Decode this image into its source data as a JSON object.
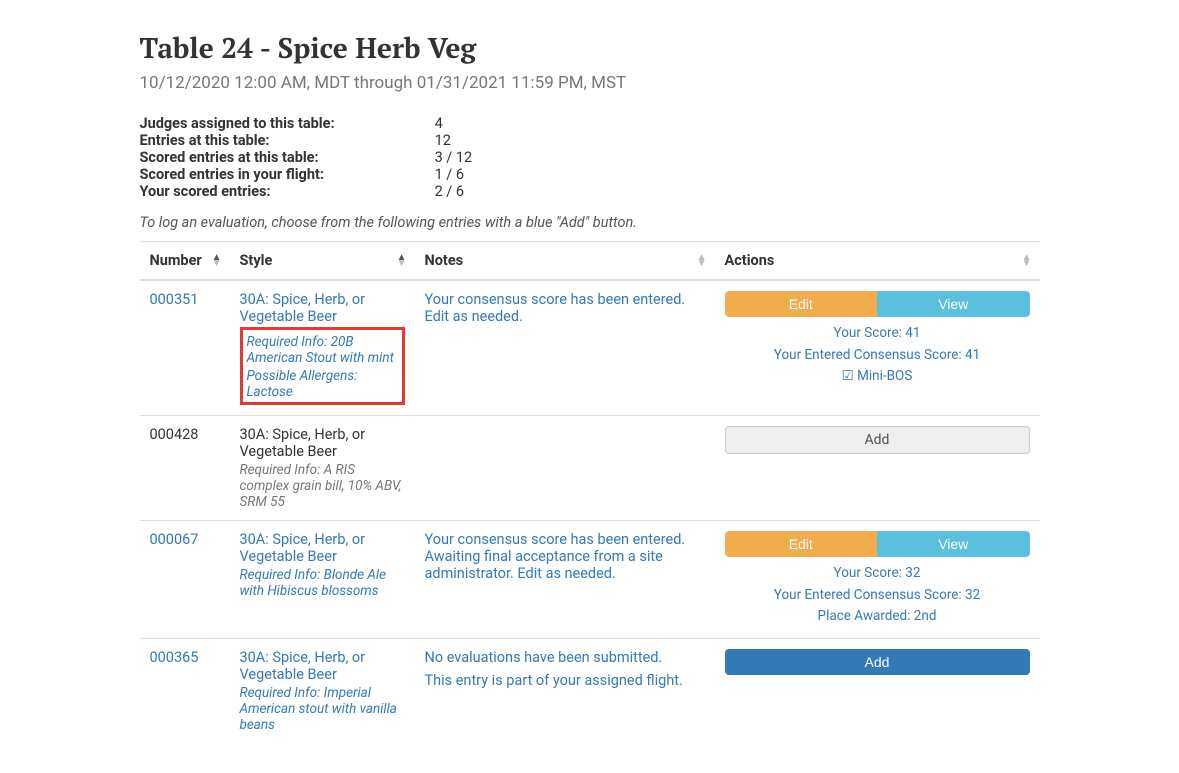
{
  "title": "Table 24 - Spice Herb Veg",
  "subtitle": "10/12/2020 12:00 AM, MDT through 01/31/2021 11:59 PM, MST",
  "stats": {
    "judges_label": "Judges assigned to this table:",
    "judges_value": "4",
    "entries_label": "Entries at this table:",
    "entries_value": "12",
    "scored_label": "Scored entries at this table:",
    "scored_value": "3 / 12",
    "flight_label": "Scored entries in your flight:",
    "flight_value": "1 / 6",
    "your_label": "Your scored entries:",
    "your_value": "2 / 6"
  },
  "instruction": "To log an evaluation, choose from the following entries with a blue \"Add\" button.",
  "headers": {
    "number": "Number",
    "style": "Style",
    "notes": "Notes",
    "actions": "Actions"
  },
  "buttons": {
    "edit": "Edit",
    "view": "View",
    "add": "Add",
    "minibos": "Mini-BOS"
  },
  "rows": [
    {
      "number": "000351",
      "style": "30A: Spice, Herb, or Vegetable Beer",
      "req1": "Required Info: 20B American Stout with mint",
      "req2": "Possible Allergens: Lactose",
      "notes": "Your consensus score has been entered. Edit as needed.",
      "score_line1": "Your Score: 41",
      "score_line2": "Your Entered Consensus Score: 41"
    },
    {
      "number": "000428",
      "style": "30A: Spice, Herb, or Vegetable Beer",
      "req1": "Required Info: A RIS complex grain bill, 10% ABV, SRM 55"
    },
    {
      "number": "000067",
      "style": "30A: Spice, Herb, or Vegetable Beer",
      "req1": "Required Info: Blonde Ale with Hibiscus blossoms",
      "notes": "Your consensus score has been entered. Awaiting final acceptance from a site administrator. Edit as needed.",
      "score_line1": "Your Score: 32",
      "score_line2": "Your Entered Consensus Score: 32",
      "score_line3": "Place Awarded: 2nd"
    },
    {
      "number": "000365",
      "style": "30A: Spice, Herb, or Vegetable Beer",
      "req1": "Required Info: Imperial American stout with vanilla beans",
      "notes1": "No evaluations have been submitted.",
      "notes2": "This entry is part of your assigned flight."
    }
  ]
}
